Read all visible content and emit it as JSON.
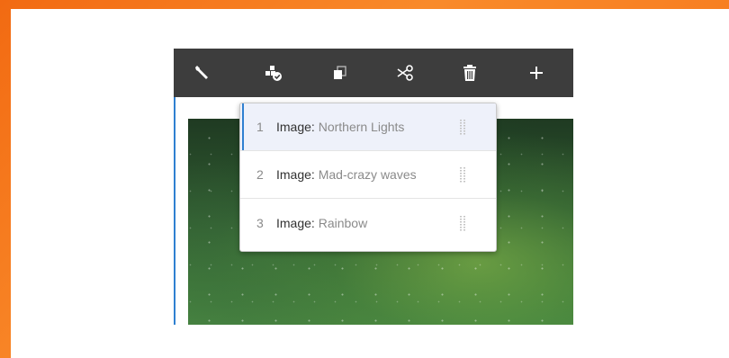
{
  "toolbar": {
    "buttons": [
      {
        "icon": "wrench-icon",
        "action": "configure"
      },
      {
        "icon": "components-check-icon",
        "action": "select-panel"
      },
      {
        "icon": "copy-icon",
        "action": "copy"
      },
      {
        "icon": "scissors-icon",
        "action": "cut"
      },
      {
        "icon": "trash-icon",
        "action": "delete"
      },
      {
        "icon": "plus-icon",
        "action": "insert"
      }
    ]
  },
  "panel_list": {
    "items": [
      {
        "number": "1",
        "kind": "Image",
        "separator": ": ",
        "title": "Northern Lights",
        "selected": true
      },
      {
        "number": "2",
        "kind": "Image",
        "separator": ": ",
        "title": "Mad-crazy waves",
        "selected": false
      },
      {
        "number": "3",
        "kind": "Image",
        "separator": ": ",
        "title": "Rainbow",
        "selected": false
      }
    ]
  },
  "colors": {
    "frame_orange": "#f77b1f",
    "toolbar_bg": "#3d3d3d",
    "selection_accent": "#2f80d1",
    "selected_row_bg": "#eef1fa"
  }
}
